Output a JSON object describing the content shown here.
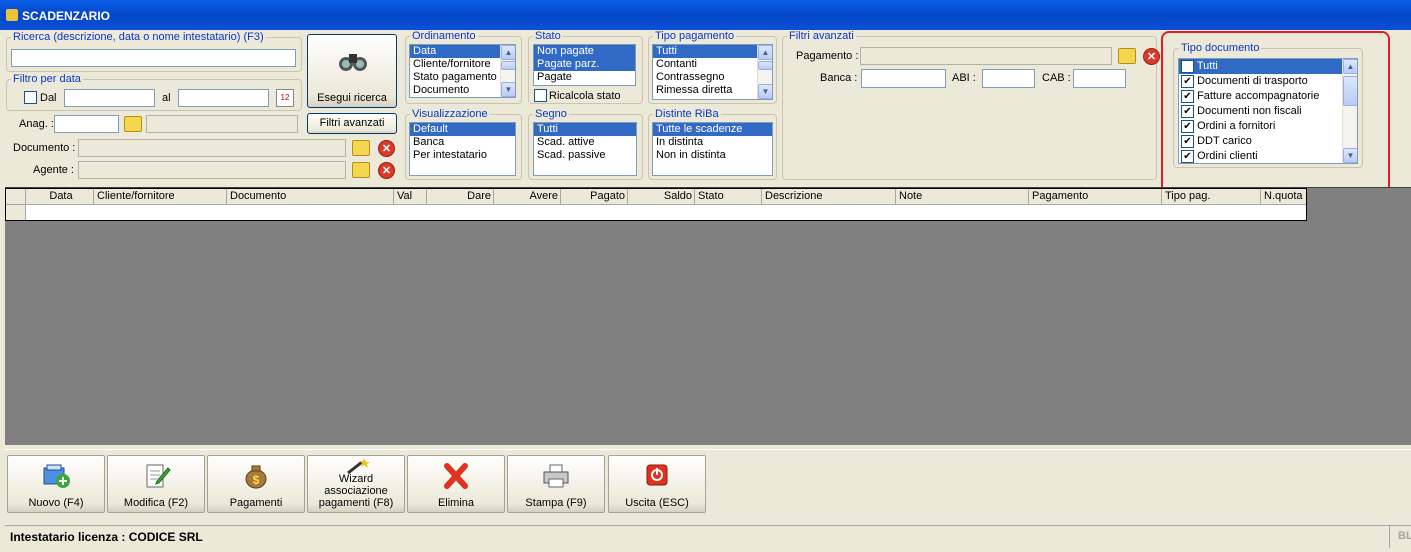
{
  "window": {
    "title": "SCADENZARIO"
  },
  "search": {
    "label": "Ricerca (descrizione, data o nome intestatario) (F3)",
    "value": ""
  },
  "date_filter": {
    "label": "Filtro per data",
    "dal": "Dal",
    "al": "al",
    "from_value": "",
    "to_value": ""
  },
  "fields": {
    "anag_label": "Anag. :",
    "documento_label": "Documento :",
    "agente_label": "Agente :"
  },
  "buttons": {
    "search": "Esegui ricerca",
    "advanced": "Filtri avanzati"
  },
  "ordinamento": {
    "title": "Ordinamento",
    "items": [
      "Data",
      "Cliente/fornitore",
      "Stato pagamento",
      "Documento"
    ],
    "selected": 0
  },
  "stato": {
    "title": "Stato",
    "items": [
      "Non pagate",
      "Pagate parz.",
      "Pagate"
    ],
    "selected": [
      0,
      1
    ],
    "recalc": "Ricalcola stato"
  },
  "tipo_pagamento": {
    "title": "Tipo pagamento",
    "items": [
      "Tutti",
      "Contanti",
      "Contrassegno",
      "Rimessa diretta"
    ],
    "selected": 0
  },
  "visualizzazione": {
    "title": "Visualizzazione",
    "items": [
      "Default",
      "Banca",
      "Per intestatario"
    ],
    "selected": 0
  },
  "segno": {
    "title": "Segno",
    "items": [
      "Tutti",
      "Scad. attive",
      "Scad. passive"
    ],
    "selected": 0
  },
  "distinte": {
    "title": "Distinte RiBa",
    "items": [
      "Tutte le scadenze",
      "In distinta",
      "Non in distinta"
    ],
    "selected": 0
  },
  "advanced": {
    "title": "Filtri avanzati",
    "pagamento": "Pagamento :",
    "banca": "Banca :",
    "abi": "ABI :",
    "cab": "CAB :"
  },
  "tipo_documento": {
    "title": "Tipo documento",
    "items": [
      "Tutti",
      "Documenti di trasporto",
      "Fatture accompagnatorie",
      "Documenti non fiscali",
      "Ordini a fornitori",
      "DDT carico",
      "Ordini clienti"
    ],
    "selected": 0
  },
  "table": {
    "columns": [
      "Data",
      "Cliente/fornitore",
      "Documento",
      "Val",
      "Dare",
      "Avere",
      "Pagato",
      "Saldo",
      "Stato",
      "Descrizione",
      "Note",
      "Pagamento",
      "Tipo pag.",
      "N.quota"
    ]
  },
  "toolbar": {
    "nuovo": "Nuovo (F4)",
    "modifica": "Modifica (F2)",
    "pagamenti": "Pagamenti",
    "wizard": "Wizard associazione pagamenti (F8)",
    "elimina": "Elimina",
    "stampa": "Stampa (F9)",
    "uscita": "Uscita (ESC)"
  },
  "status": {
    "license": "Intestatario licenza : CODICE SRL",
    "right": "BL"
  },
  "colors": {
    "accent": "#316ac5",
    "highlight": "#e31b23",
    "group_title": "#0b36c8"
  }
}
